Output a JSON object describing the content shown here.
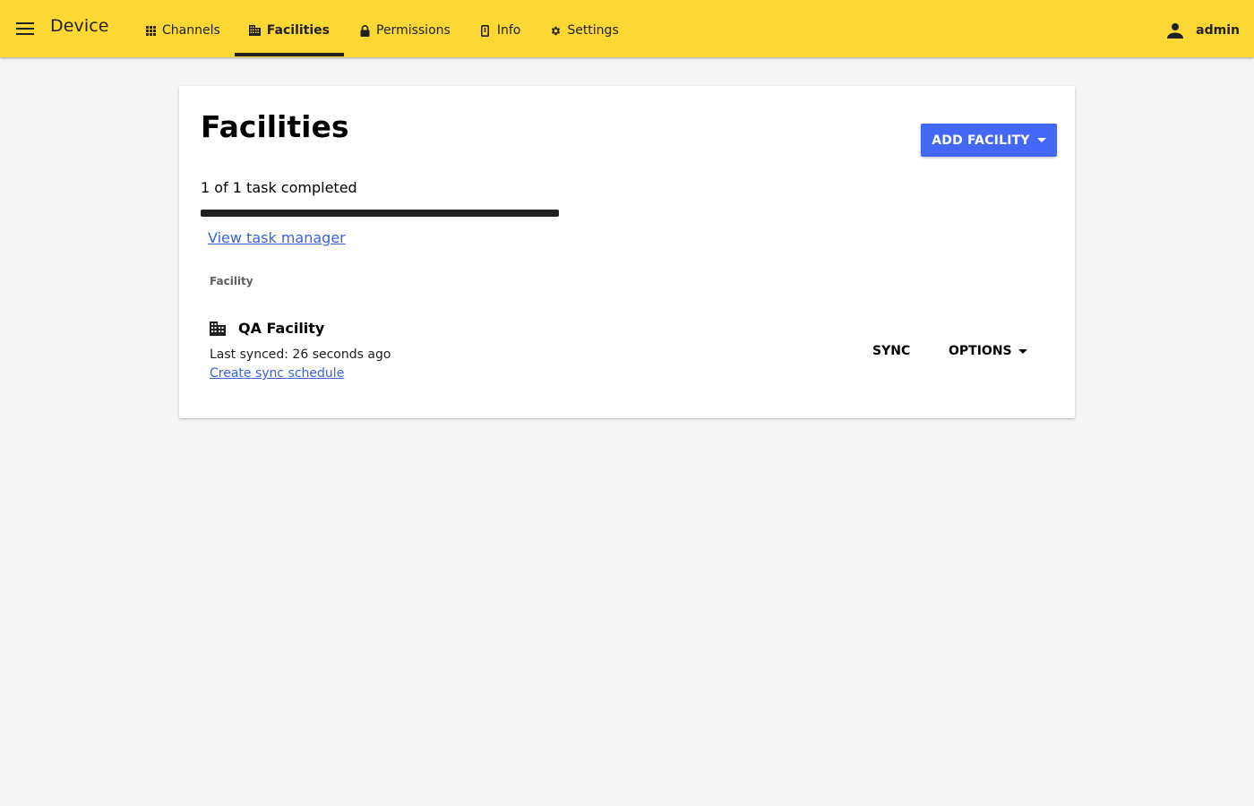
{
  "appbar": {
    "title": "Device",
    "background": "#fdd835",
    "menu_icon": "menu-icon",
    "tabs": [
      {
        "label": "Channels",
        "icon": "apps-grid-icon",
        "active": false
      },
      {
        "label": "Facilities",
        "icon": "facility-icon",
        "active": true
      },
      {
        "label": "Permissions",
        "icon": "lock-icon",
        "active": false
      },
      {
        "label": "Info",
        "icon": "device-info-icon",
        "active": false
      },
      {
        "label": "Settings",
        "icon": "gear-icon",
        "active": false
      }
    ],
    "user": {
      "name": "admin",
      "icon": "person-icon"
    }
  },
  "main": {
    "title": "Facilities",
    "add_button": {
      "label": "ADD FACILITY",
      "color": "#4368f5",
      "icon": "caret-down-icon"
    },
    "task": {
      "status": "1 of 1 task completed",
      "progress": 1.0,
      "link": "View task manager"
    },
    "table": {
      "column_header": "Facility",
      "rows": [
        {
          "name": "QA Facility",
          "icon": "facility-icon",
          "last_synced": "Last synced: 26 seconds ago",
          "schedule_link": "Create sync schedule",
          "sync_label": "SYNC",
          "options_label": "OPTIONS"
        }
      ]
    }
  },
  "colors": {
    "link": "#3b63d6",
    "page_background": "#f5f5f5"
  }
}
